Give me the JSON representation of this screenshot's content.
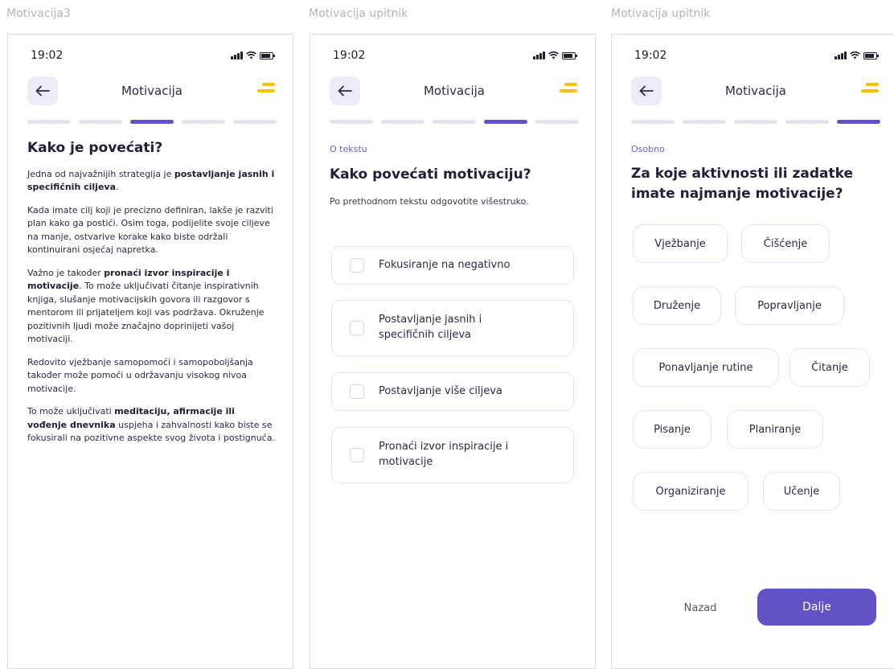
{
  "frames": [
    {
      "label": "Motivacija3",
      "status": {
        "time": "19:02"
      },
      "header": {
        "title": "Motivacija"
      },
      "content": {
        "heading": "Kako je povećati?",
        "p1": [
          "Jedna od najvažnijih strategija je ",
          "postavljanje jasnih i specifičnih ciljeva",
          "."
        ],
        "p2": "Kada imate cilj koji je precizno definiran, lakše je razviti plan kako ga postići. Osim toga, podijelite svoje ciljeve na manje, ostvarive korake kako biste održali kontinuirani osjećaj napretka.",
        "p3": [
          "Važno je također ",
          "pronaći izvor inspiracije i motivacije",
          ". To može uključivati čitanje inspirativnih knjiga, slušanje motivacijskih govora ili razgovor s mentorom ili prijateljem koji vas podržava. Okruženje pozitivnih ljudi može značajno doprinijeti vašoj motivaciji."
        ],
        "p4": "Redovito vježbanje samopomoći i samopoboljšanja također može pomoći u održavanju visokog nivoa motivacije.",
        "p5": [
          "To može uključivati ",
          "meditaciju, afirmacije ili vođenje dnevnika",
          " uspjeha i zahvalnosti kako biste se fokusirali na pozitivne aspekte svog života i postignuća."
        ]
      }
    },
    {
      "label": "Motivacija upitnik",
      "status": {
        "time": "19:02"
      },
      "header": {
        "title": "Motivacija"
      },
      "section_label": "O tekstu",
      "heading": "Kako povećati motivaciju?",
      "instruction": "Po prethodnom tekstu odgovotite višestruko.",
      "options": [
        "Fokusiranje na negativno",
        "Postavljanje jasnih i specifičnih ciljeva",
        "Postavljanje više ciljeva",
        "Pronaći izvor inspiracije i motivacije"
      ]
    },
    {
      "label": "Motivacija upitnik",
      "status": {
        "time": "19:02"
      },
      "header": {
        "title": "Motivacija"
      },
      "section_label": "Osobno",
      "heading": "Za koje aktivnosti ili zadatke imate najmanje motivacije?",
      "chips": [
        "Vježbanje",
        "Čišćenje",
        "Druženje",
        "Popravljanje",
        "Ponavljanje rutine",
        "Čitanje",
        "Pisanje",
        "Planiranje",
        "Organiziranje",
        "Učenje"
      ],
      "buttons": {
        "back": "Nazad",
        "next": "Dalje"
      }
    }
  ],
  "progress_active_index": [
    2,
    3,
    4
  ],
  "progress_segments": 5,
  "colors": {
    "accent": "#5f53c5",
    "menu_icon": "#f5c20b",
    "back_btn_bg": "#ecebfa",
    "section_label": "#6a5ed0"
  },
  "icons": {
    "back": "arrow-left-icon",
    "menu": "menu-icon",
    "signal": "signal-icon",
    "wifi": "wifi-icon",
    "battery": "battery-icon"
  }
}
